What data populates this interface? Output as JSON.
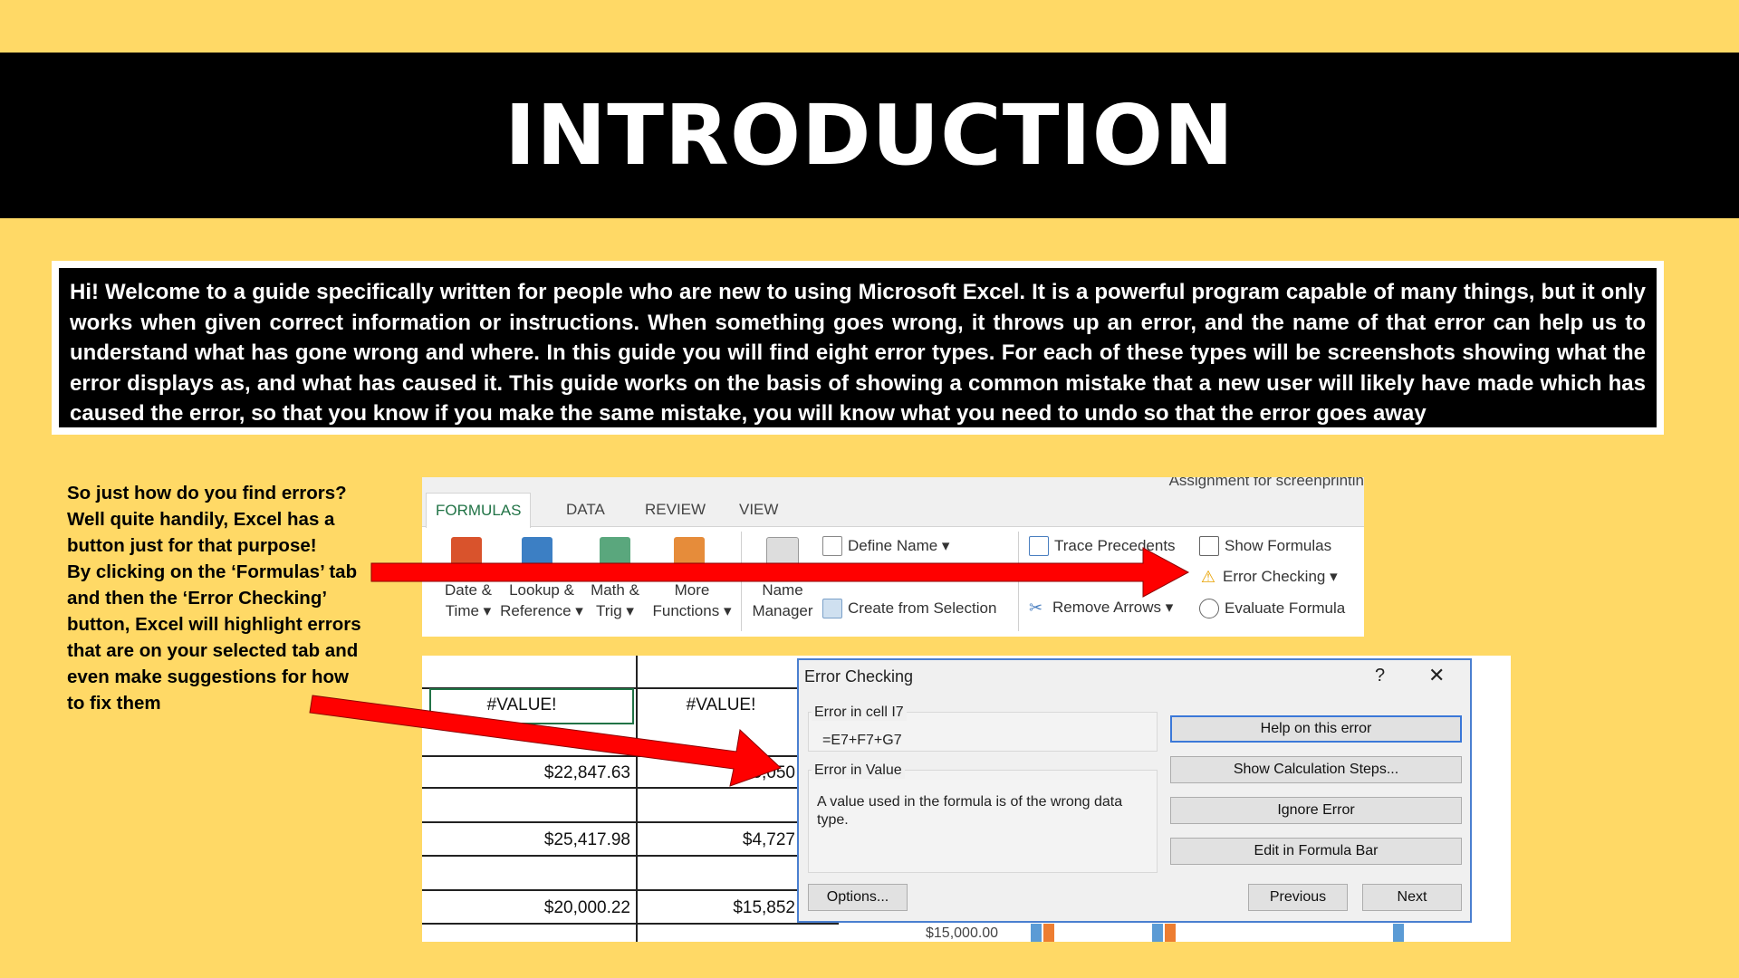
{
  "slide": {
    "title": "INTRODUCTION",
    "intro_text": "Hi! Welcome to a guide specifically written for people who are new to using Microsoft Excel. It is a powerful program capable of many things, but it only works when given correct information or instructions. When something goes wrong, it throws up an error, and the name of that error can help us to understand what has gone wrong and where. In this guide you will find eight error types. For each of these types will be screenshots showing what the error displays as, and what has caused it. This guide works on the basis of showing a common mistake that a new user will likely have made which has caused the error, so that you know if you make the same mistake, you will know what you need to undo so that the error goes away",
    "side_lines": [
      "So just how do you find errors?",
      "Well quite handily, Excel has a",
      "button just for that purpose!",
      "By clicking on the ‘Formulas’ tab",
      "and then the ‘Error Checking’",
      "button, Excel will highlight errors",
      "that are on your selected tab and",
      "even make suggestions for how",
      "to fix them"
    ]
  },
  "ribbon": {
    "doc_title": "Assignment for screenprintin",
    "tabs": [
      "FORMULAS",
      "DATA",
      "REVIEW",
      "VIEW"
    ],
    "groups": {
      "date_time": [
        "Date &",
        "Time ▾"
      ],
      "lookup": [
        "Lookup &",
        "Reference ▾"
      ],
      "math": [
        "Math &",
        "Trig ▾"
      ],
      "more": [
        "More",
        "Functions ▾"
      ],
      "name_manager": [
        "Name",
        "Manager"
      ]
    },
    "define_name": "Define Name ▾",
    "create_from_selection": "Create from Selection",
    "trace_precedents": "Trace Precedents",
    "remove_arrows": "Remove Arrows ▾",
    "show_formulas": "Show Formulas",
    "error_checking": "Error Checking ▾",
    "evaluate_formula": "Evaluate Formula"
  },
  "sheet": {
    "cells": [
      "#VALUE!",
      "#VALUE!",
      "$22,847.63",
      "$5,050",
      "$25,417.98",
      "$4,727",
      "$20,000.22",
      "$15,852"
    ],
    "axis_label": "$15,000.00"
  },
  "dialog": {
    "title": "Error Checking",
    "help_glyph": "?",
    "close_glyph": "✕",
    "error_cell_label": "Error in cell I7",
    "formula": "=E7+F7+G7",
    "error_type_label": "Error in Value",
    "description": "A value used in the formula is of the wrong data type.",
    "buttons": {
      "help": "Help on this error",
      "steps": "Show Calculation Steps...",
      "ignore": "Ignore Error",
      "edit": "Edit in Formula Bar",
      "options": "Options...",
      "previous": "Previous",
      "next": "Next"
    }
  },
  "colors": {
    "background": "#FFD966",
    "arrow": "#FF0000",
    "excel_green": "#217346"
  }
}
